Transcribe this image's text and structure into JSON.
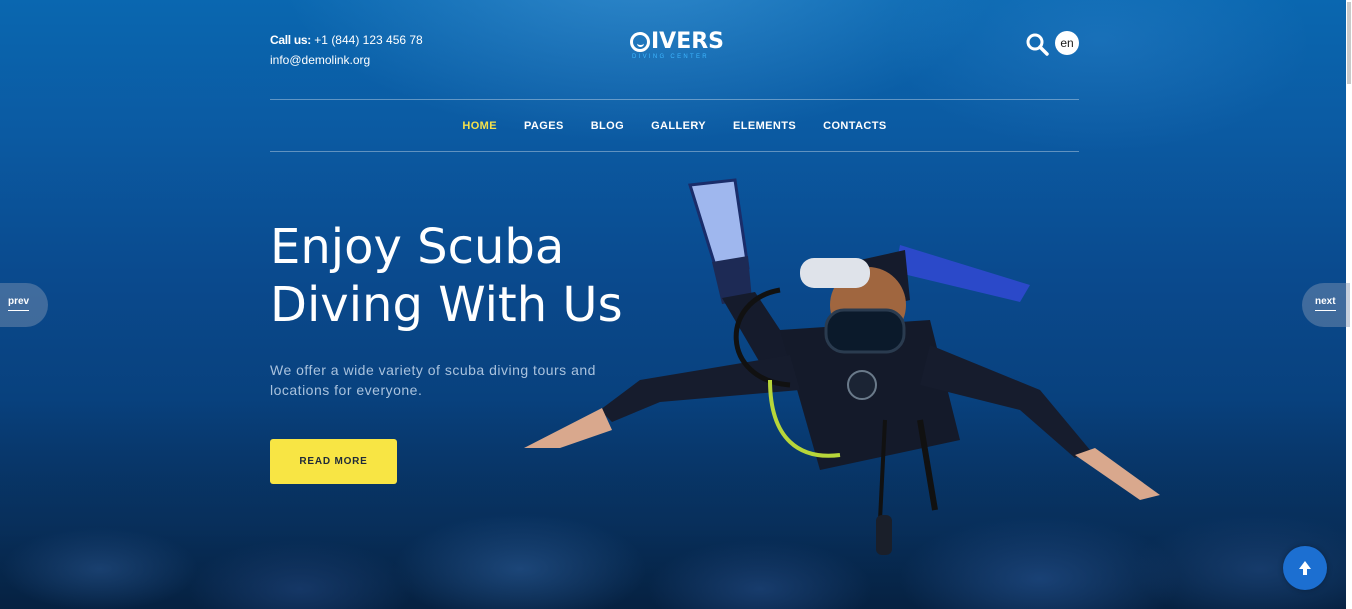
{
  "header": {
    "call_label": "Call us:",
    "phone": "+1 (844) 123 456 78",
    "email": "info@demolink.org",
    "logo_text": "IVERS",
    "logo_tagline": "DIVING CENTER",
    "lang": "en"
  },
  "nav": {
    "items": [
      {
        "label": "HOME",
        "active": true
      },
      {
        "label": "PAGES"
      },
      {
        "label": "BLOG"
      },
      {
        "label": "GALLERY"
      },
      {
        "label": "ELEMENTS"
      },
      {
        "label": "CONTACTS"
      }
    ]
  },
  "hero": {
    "headline_line1": "Enjoy Scuba",
    "headline_line2": "Diving With Us",
    "subtext": "We offer a wide variety of scuba diving tours and locations for everyone.",
    "cta_label": "READ MORE"
  },
  "slider": {
    "prev_label": "prev",
    "next_label": "next"
  },
  "icons": {
    "search": "search-icon",
    "to_top": "arrow-up-icon",
    "logo_mark": "logo-o-icon"
  },
  "colors": {
    "accent_yellow": "#f8e544",
    "active_nav": "#f5e14b",
    "ocean_blue": "#0a4a8e",
    "to_top_blue": "#1c6fd1"
  }
}
